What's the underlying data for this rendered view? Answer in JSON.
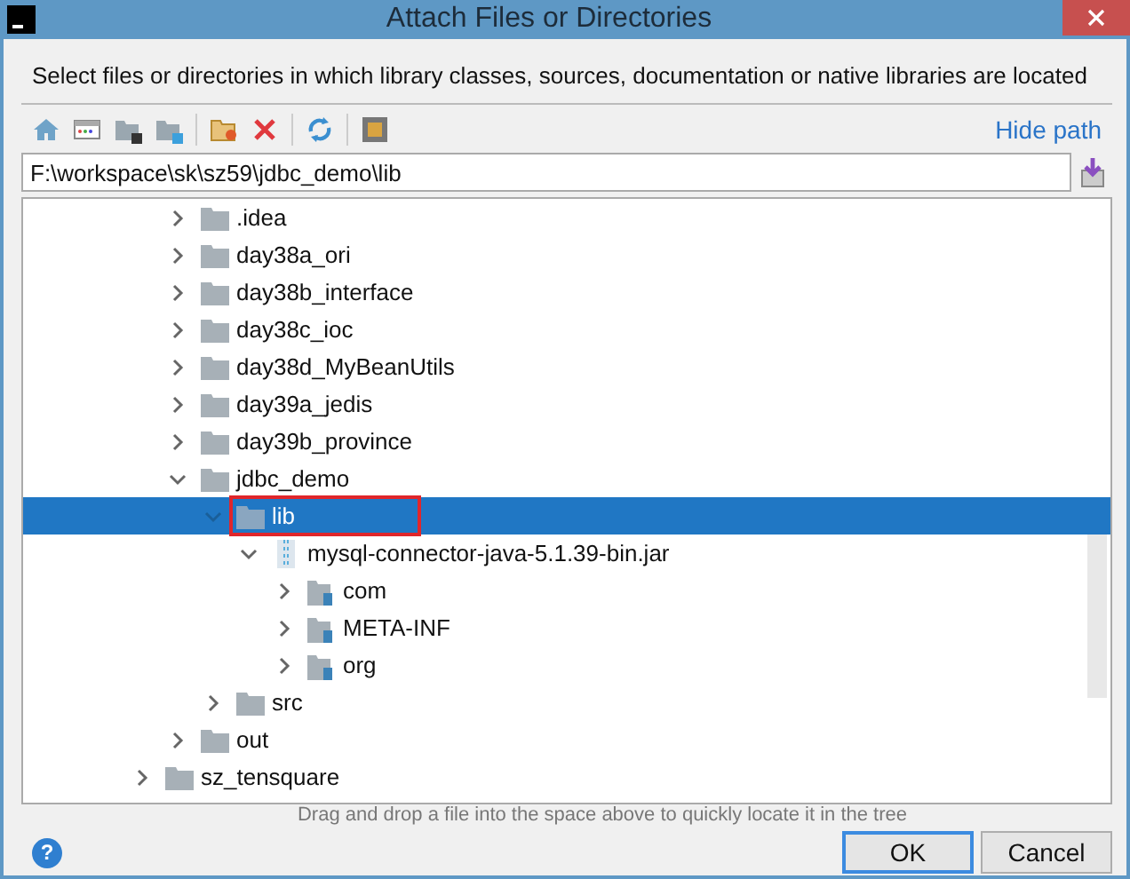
{
  "window": {
    "title": "Attach Files or Directories"
  },
  "description": "Select files or directories in which library classes, sources, documentation or native libraries are located",
  "toolbar": {
    "hide_path": "Hide path"
  },
  "path_field": {
    "value": "F:\\workspace\\sk\\sz59\\jdbc_demo\\lib"
  },
  "tree": [
    {
      "name": ".idea",
      "kind": "folder",
      "expanded": false,
      "selected": false
    },
    {
      "name": "day38a_ori",
      "kind": "folder",
      "expanded": false,
      "selected": false
    },
    {
      "name": "day38b_interface",
      "kind": "folder",
      "expanded": false,
      "selected": false
    },
    {
      "name": "day38c_ioc",
      "kind": "folder",
      "expanded": false,
      "selected": false
    },
    {
      "name": "day38d_MyBeanUtils",
      "kind": "folder",
      "expanded": false,
      "selected": false
    },
    {
      "name": "day39a_jedis",
      "kind": "folder",
      "expanded": false,
      "selected": false
    },
    {
      "name": "day39b_province",
      "kind": "folder",
      "expanded": false,
      "selected": false
    },
    {
      "name": "jdbc_demo",
      "kind": "folder",
      "expanded": true,
      "selected": false,
      "children": [
        {
          "name": "lib",
          "kind": "folder",
          "expanded": true,
          "selected": true,
          "highlighted": true,
          "children": [
            {
              "name": "mysql-connector-java-5.1.39-bin.jar",
              "kind": "jar",
              "expanded": true,
              "selected": false,
              "children": [
                {
                  "name": "com",
                  "kind": "package",
                  "expanded": false,
                  "selected": false
                },
                {
                  "name": "META-INF",
                  "kind": "package",
                  "expanded": false,
                  "selected": false
                },
                {
                  "name": "org",
                  "kind": "package",
                  "expanded": false,
                  "selected": false
                }
              ]
            }
          ]
        },
        {
          "name": "src",
          "kind": "folder",
          "expanded": false,
          "selected": false
        }
      ]
    },
    {
      "name": "out",
      "kind": "folder",
      "expanded": false,
      "selected": false
    }
  ],
  "tree_outer": [
    {
      "name": "sz_tensquare",
      "kind": "folder",
      "expanded": false,
      "selected": false
    }
  ],
  "hint": "Drag and drop a file into the space above to quickly locate it in the tree",
  "help": "?",
  "buttons": [
    {
      "label": "OK",
      "kind": "default"
    },
    {
      "label": "Cancel",
      "kind": "normal"
    }
  ]
}
